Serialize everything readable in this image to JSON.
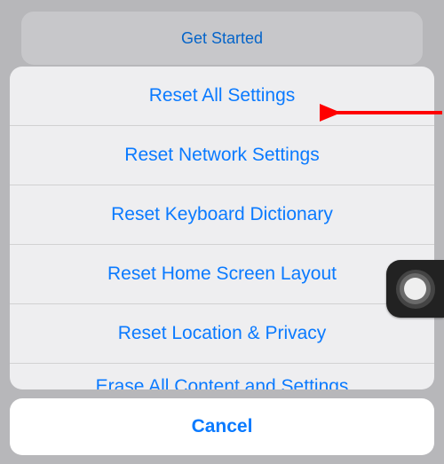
{
  "background": {
    "get_started_label": "Get Started"
  },
  "action_sheet": {
    "items": [
      {
        "label": "Reset All Settings"
      },
      {
        "label": "Reset Network Settings"
      },
      {
        "label": "Reset Keyboard Dictionary"
      },
      {
        "label": "Reset Home Screen Layout"
      },
      {
        "label": "Reset Location & Privacy"
      }
    ],
    "partial_item_label": "Erase All Content and Settings",
    "cancel_label": "Cancel"
  },
  "annotation": {
    "arrow_color": "#ff0000"
  }
}
